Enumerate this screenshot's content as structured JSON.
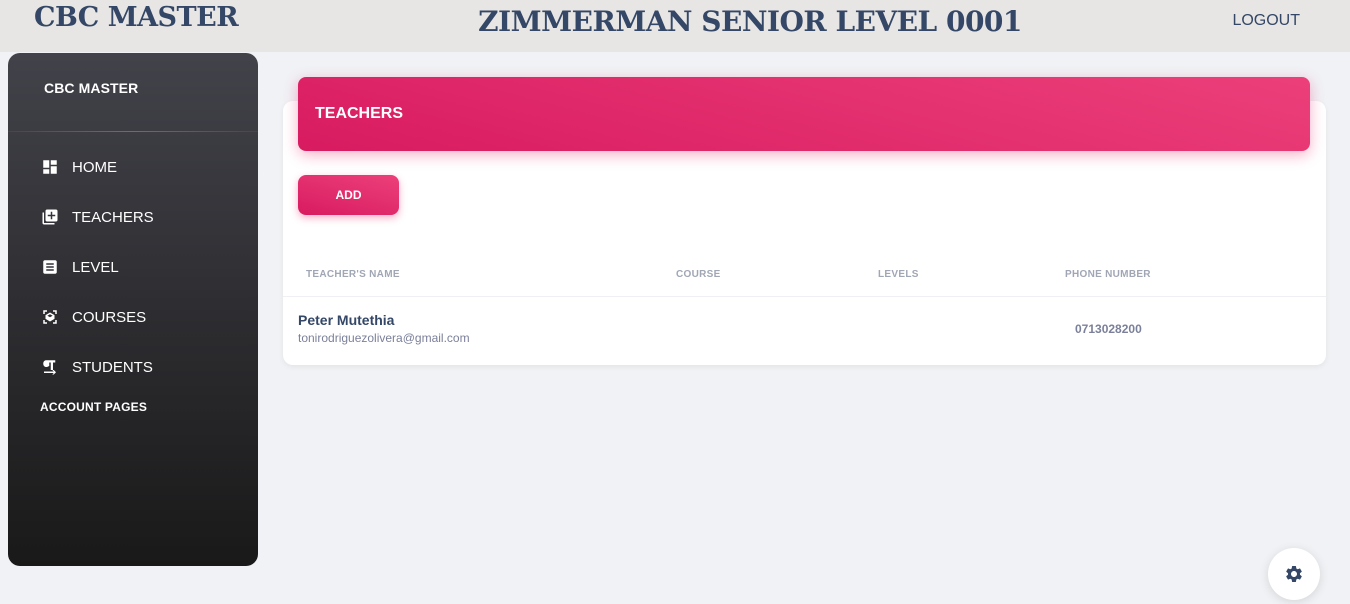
{
  "header": {
    "brand": "CBC MASTER",
    "school_title": "ZIMMERMAN SENIOR LEVEL 0001",
    "logout_label": "LOGOUT"
  },
  "sidebar": {
    "brand": "CBC MASTER",
    "items": [
      {
        "label": "HOME",
        "icon": "dashboard-icon"
      },
      {
        "label": "TEACHERS",
        "icon": "teachers-icon"
      },
      {
        "label": "LEVEL",
        "icon": "level-icon"
      },
      {
        "label": "COURSES",
        "icon": "courses-icon"
      },
      {
        "label": "STUDENTS",
        "icon": "students-icon"
      }
    ],
    "section_title": "ACCOUNT PAGES"
  },
  "main": {
    "card_title": "TEACHERS",
    "add_label": "ADD",
    "columns": [
      "TEACHER'S NAME",
      "COURSE",
      "LEVELS",
      "PHONE NUMBER"
    ],
    "rows": [
      {
        "name": "Peter Mutethia",
        "email": "tonirodriguezolivera@gmail.com",
        "course": "",
        "levels": "",
        "phone": "0713028200"
      }
    ]
  },
  "settings": {
    "icon": "gear-icon"
  },
  "colors": {
    "accent": "#e91e63",
    "sidebar_dark": "#191919",
    "text": "#344767"
  }
}
